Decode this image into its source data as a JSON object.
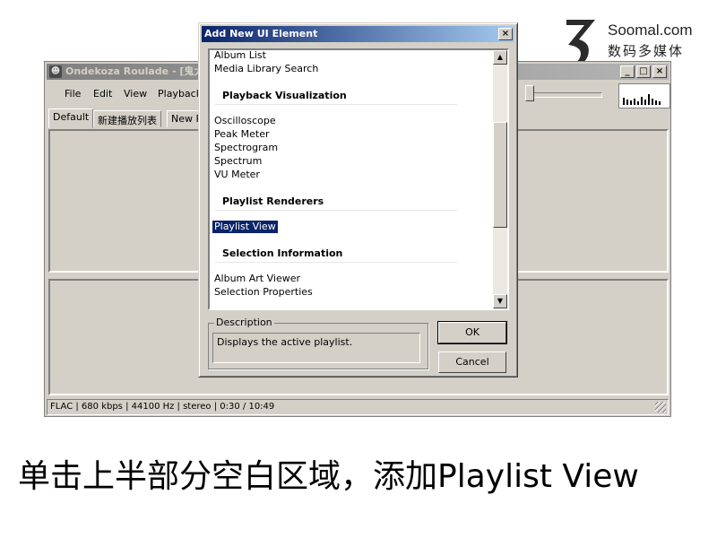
{
  "watermark": {
    "site": "Soomal.com",
    "tagline": "数码多媒体"
  },
  "main_window": {
    "title": "Ondekoza Roulade - [鬼太",
    "controls": {
      "minimize": "_",
      "maximize": "□",
      "close": "×"
    },
    "menu": [
      "File",
      "Edit",
      "View",
      "Playback"
    ],
    "tabs": [
      "Default",
      "新建播放列表",
      "New P"
    ],
    "status": "FLAC | 680 kbps | 44100 Hz | stereo | 0:30 / 10:49"
  },
  "dialog": {
    "title": "Add New UI Element",
    "close": "×",
    "list": {
      "top_items": [
        "Album List",
        "Media Library Search"
      ],
      "groups": [
        {
          "name": "Playback Visualization",
          "items": [
            "Oscilloscope",
            "Peak Meter",
            "Spectrogram",
            "Spectrum",
            "VU Meter"
          ]
        },
        {
          "name": "Playlist Renderers",
          "items": [
            "Playlist View"
          ]
        },
        {
          "name": "Selection Information",
          "items": [
            "Album Art Viewer",
            "Selection Properties"
          ]
        }
      ],
      "selected": "Playlist View"
    },
    "scroll_up": "▲",
    "scroll_down": "▼",
    "description_label": "Description",
    "description_text": "Displays the active playlist.",
    "ok_label": "OK",
    "cancel_label": "Cancel"
  },
  "caption": "单击上半部分空白区域，添加Playlist View"
}
